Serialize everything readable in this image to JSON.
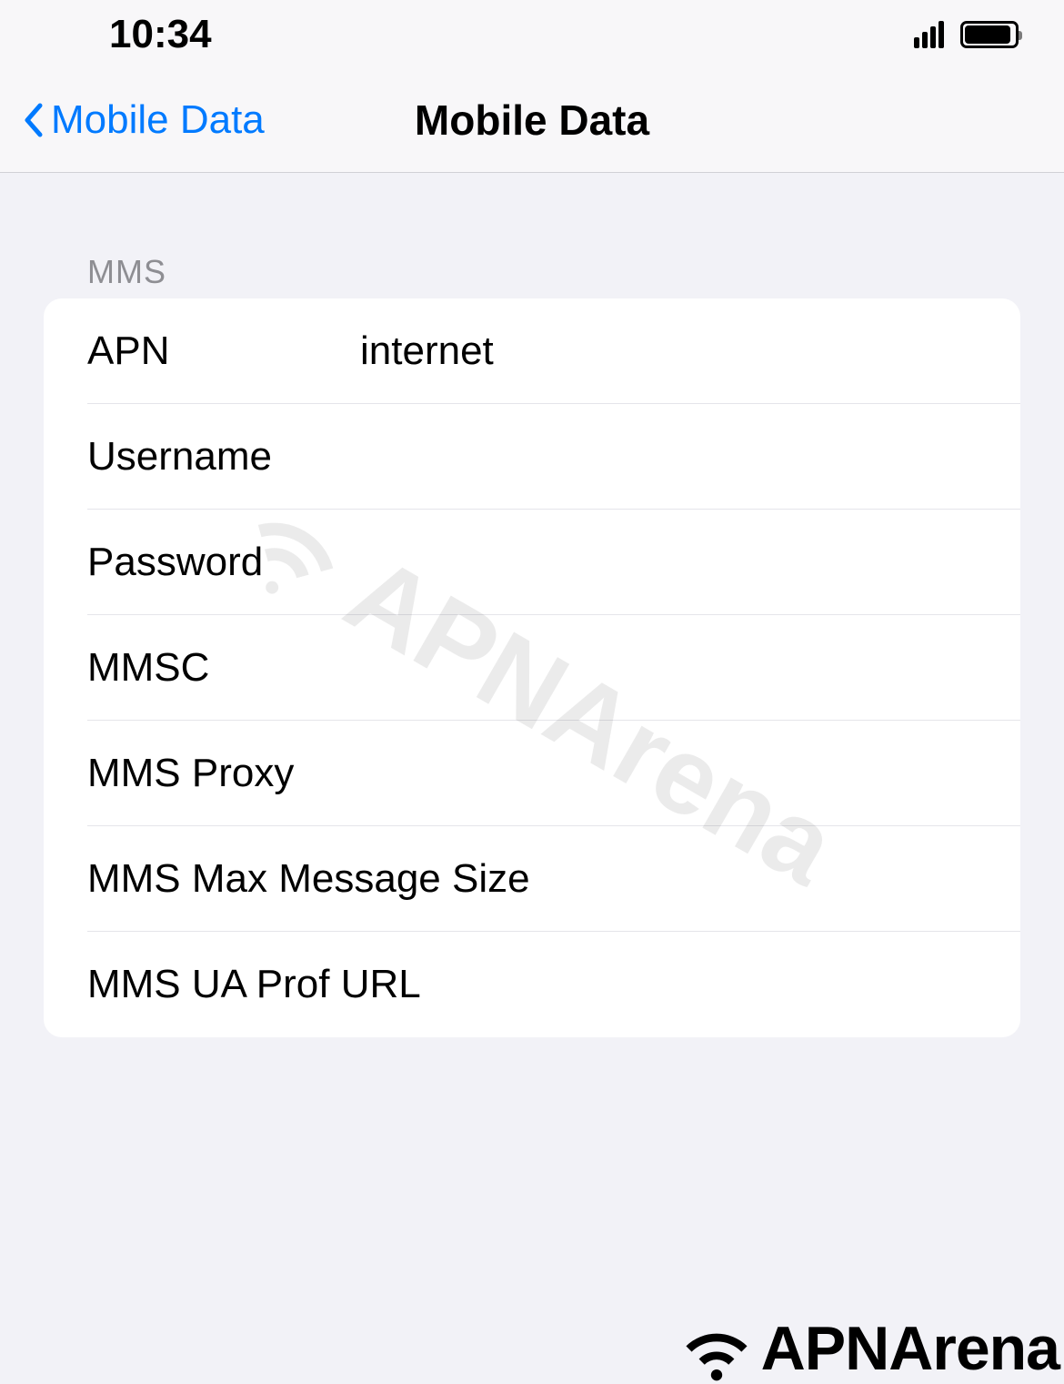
{
  "status_bar": {
    "time": "10:34"
  },
  "nav": {
    "back_label": "Mobile Data",
    "title": "Mobile Data"
  },
  "section_header": "MMS",
  "rows": {
    "apn": {
      "label": "APN",
      "value": "internet"
    },
    "username": {
      "label": "Username",
      "value": ""
    },
    "password": {
      "label": "Password",
      "value": ""
    },
    "mmsc": {
      "label": "MMSC",
      "value": ""
    },
    "mms_proxy": {
      "label": "MMS Proxy",
      "value": ""
    },
    "mms_max": {
      "label": "MMS Max Message Size",
      "value": ""
    },
    "mms_ua": {
      "label": "MMS UA Prof URL",
      "value": ""
    }
  },
  "watermark_text": "APNArena",
  "footer_text": "APNArena"
}
